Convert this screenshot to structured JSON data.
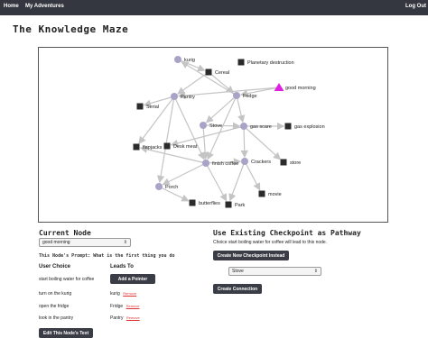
{
  "nav": {
    "home": "Home",
    "my_adventures": "My Adventures",
    "logout": "Log Out"
  },
  "app_title": "The Knowledge Maze",
  "graph": {
    "nodes": [
      {
        "label": "kurig",
        "shape": "circle"
      },
      {
        "label": "Planetary destruction",
        "shape": "square"
      },
      {
        "label": "Cereal",
        "shape": "square"
      },
      {
        "label": "good morning",
        "shape": "triangle"
      },
      {
        "label": "Pantry",
        "shape": "circle"
      },
      {
        "label": "Fridge",
        "shape": "circle"
      },
      {
        "label": "Serial",
        "shape": "square"
      },
      {
        "label": "Stove",
        "shape": "circle"
      },
      {
        "label": "gas scare",
        "shape": "circle"
      },
      {
        "label": "gas explosion",
        "shape": "square"
      },
      {
        "label": "flapjacks",
        "shape": "square"
      },
      {
        "label": "Desk meat",
        "shape": "square"
      },
      {
        "label": "finish coffee",
        "shape": "circle"
      },
      {
        "label": "Crackers",
        "shape": "circle"
      },
      {
        "label": "store",
        "shape": "square"
      },
      {
        "label": "Porch",
        "shape": "circle"
      },
      {
        "label": "movie",
        "shape": "square"
      },
      {
        "label": "butterflies",
        "shape": "square"
      },
      {
        "label": "Park",
        "shape": "square"
      }
    ],
    "colors": {
      "circle": "#a8a4c8",
      "square": "#2b2b2b",
      "triangle": "#e020e0",
      "edge": "#c4c4c4"
    }
  },
  "current_node": {
    "title": "Current Node",
    "selected": "good morning",
    "prompt_label": "This Node's Prompt:",
    "prompt_text": "What is the first thing you do"
  },
  "choices": {
    "user_choice_header": "User Choice",
    "leads_to_header": "Leads To",
    "add_pointer_label": "Add a Pointer",
    "remove_label": "Remove",
    "rows": [
      {
        "choice": "start boiling water for coffee",
        "target": ""
      },
      {
        "choice": "turn on the kurig",
        "target": "kurig"
      },
      {
        "choice": "open the fridge",
        "target": "Fridge"
      },
      {
        "choice": "look in the pantry",
        "target": "Pantry"
      }
    ],
    "edit_text_label": "Edit This Node's Text"
  },
  "checkpoint": {
    "title": "Use Existing Checkpoint as Pathway",
    "description": "Choice start boiling water for coffee will lead to this node.",
    "create_new_label": "Create New Checkpoint Instead",
    "selected_checkpoint": "Stove",
    "create_connection_label": "Create Connection"
  }
}
